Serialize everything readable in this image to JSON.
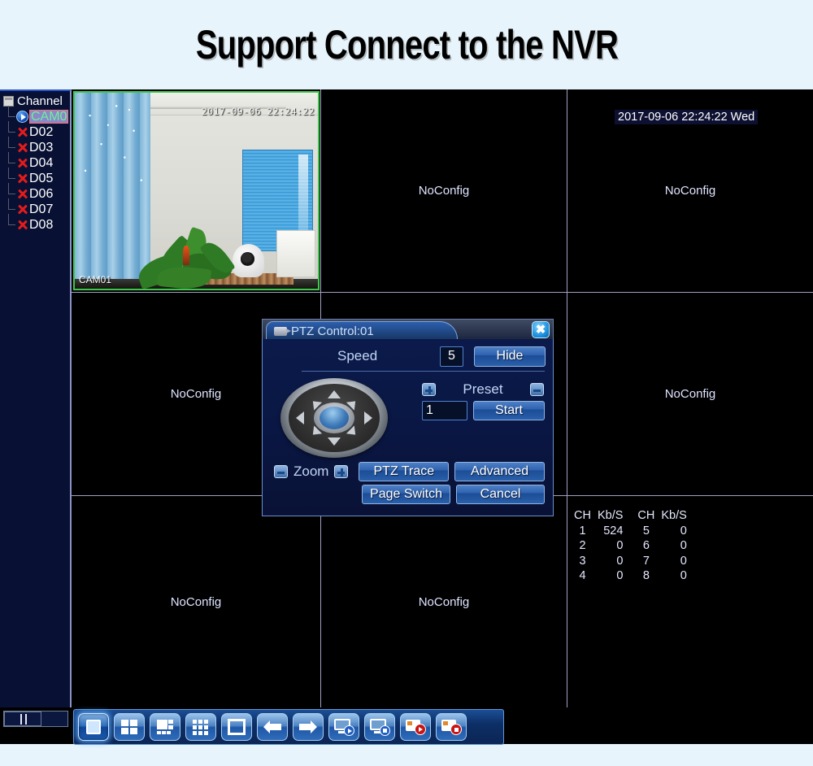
{
  "banner": {
    "title": "Support Connect to the NVR"
  },
  "sidebar": {
    "header_label": "Channel",
    "header_icon": "document-icon",
    "items": [
      {
        "label": "CAM0",
        "icon": "play-circle-icon",
        "state": "connected",
        "selected": true
      },
      {
        "label": "D02",
        "icon": "red-x-icon",
        "state": "disconnected",
        "selected": false
      },
      {
        "label": "D03",
        "icon": "red-x-icon",
        "state": "disconnected",
        "selected": false
      },
      {
        "label": "D04",
        "icon": "red-x-icon",
        "state": "disconnected",
        "selected": false
      },
      {
        "label": "D05",
        "icon": "red-x-icon",
        "state": "disconnected",
        "selected": false
      },
      {
        "label": "D06",
        "icon": "red-x-icon",
        "state": "disconnected",
        "selected": false
      },
      {
        "label": "D07",
        "icon": "red-x-icon",
        "state": "disconnected",
        "selected": false
      },
      {
        "label": "D08",
        "icon": "red-x-icon",
        "state": "disconnected",
        "selected": false
      }
    ]
  },
  "grid": {
    "live_pane": {
      "timestamp": "2017-09-06 22:24:22",
      "camera_name": "CAM01",
      "border_color": "#3ec74c"
    },
    "osd_time": "2017-09-06 22:24:22 Wed",
    "no_config_label": "NoConfig",
    "panes": [
      {
        "id": "r1c2",
        "label": "NoConfig"
      },
      {
        "id": "r1c3",
        "label": "NoConfig"
      },
      {
        "id": "r2c1",
        "label": "NoConfig"
      },
      {
        "id": "r2c3",
        "label": "NoConfig"
      },
      {
        "id": "r3c1",
        "label": "NoConfig"
      },
      {
        "id": "r3c2",
        "label": "NoConfig"
      }
    ]
  },
  "bitrate": {
    "headers": [
      "CH",
      "Kb/S",
      "CH",
      "Kb/S"
    ],
    "rows": [
      [
        "1",
        "524",
        "5",
        "0"
      ],
      [
        "2",
        "0",
        "6",
        "0"
      ],
      [
        "3",
        "0",
        "7",
        "0"
      ],
      [
        "4",
        "0",
        "8",
        "0"
      ]
    ]
  },
  "ptz_dialog": {
    "title": "PTZ Control:01",
    "title_icon": "camera-icon",
    "close_label": "✖",
    "speed_label": "Speed",
    "speed_value": "5",
    "hide_label": "Hide",
    "preset_label": "Preset",
    "preset_plus_icon": "plus-box-icon",
    "preset_minus_icon": "minus-box-icon",
    "preset_value": "1",
    "start_label": "Start",
    "zoom_label": "Zoom",
    "zoom_minus_icon": "minus-box-icon",
    "zoom_plus_icon": "plus-box-icon",
    "ptz_trace_label": "PTZ Trace",
    "advanced_label": "Advanced",
    "page_switch_label": "Page Switch",
    "cancel_label": "Cancel",
    "dpad_name": "direction-pad"
  },
  "toolbar": {
    "buttons": [
      {
        "name": "view-single-button",
        "icon": "single-view-icon",
        "active": true
      },
      {
        "name": "view-quad-button",
        "icon": "quad-view-icon",
        "active": false
      },
      {
        "name": "view-six-button",
        "icon": "six-view-icon",
        "active": false
      },
      {
        "name": "view-nine-button",
        "icon": "nine-view-icon",
        "active": false
      },
      {
        "name": "fullscreen-button",
        "icon": "fullscreen-icon",
        "active": false
      },
      {
        "name": "previous-page-button",
        "icon": "arrow-left-icon",
        "active": false
      },
      {
        "name": "next-page-button",
        "icon": "arrow-right-icon",
        "active": false
      },
      {
        "name": "start-tour-button",
        "icon": "monitor-play-icon",
        "active": false
      },
      {
        "name": "stop-tour-button",
        "icon": "monitor-stop-icon",
        "active": false
      },
      {
        "name": "start-record-button",
        "icon": "file-record-play-icon",
        "active": false
      },
      {
        "name": "stop-record-button",
        "icon": "file-record-stop-icon",
        "active": false
      }
    ]
  },
  "scrollbar": {
    "name": "sidebar-horizontal-scrollbar"
  },
  "colors": {
    "page_background": "#e8f4fb",
    "sidebar_background": "#081134",
    "grid_divider": "#a59ec2",
    "live_border": "#3ec74c",
    "selected_text": "#6ef09a",
    "accent_blue": "#2f63b1"
  }
}
